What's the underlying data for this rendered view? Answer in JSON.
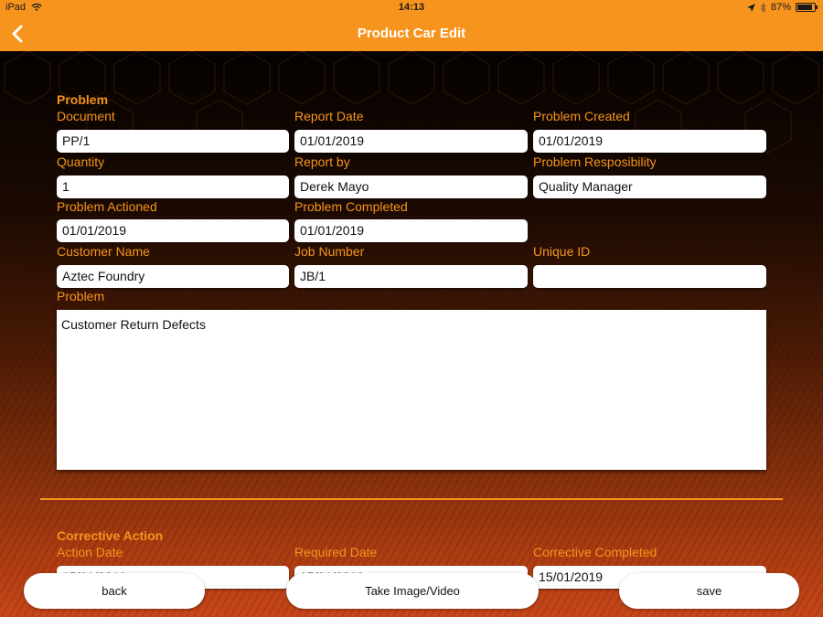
{
  "status_bar": {
    "device": "iPad",
    "time": "14:13",
    "battery": "87%",
    "battery_level": 0.87
  },
  "nav": {
    "title": "Product Car Edit",
    "back_icon": "chevron-left-icon"
  },
  "problem_section": {
    "title": "Problem",
    "fields": {
      "document": {
        "label": "Document",
        "value": "PP/1"
      },
      "report_date": {
        "label": "Report Date",
        "value": "01/01/2019"
      },
      "problem_created": {
        "label": "Problem Created",
        "value": "01/01/2019"
      },
      "quantity": {
        "label": "Quantity",
        "value": "1"
      },
      "report_by": {
        "label": "Report by",
        "value": "Derek Mayo"
      },
      "problem_responsibility": {
        "label": "Problem Resposibility",
        "value": "Quality Manager"
      },
      "problem_actioned": {
        "label": "Problem Actioned",
        "value": "01/01/2019"
      },
      "problem_completed": {
        "label": "Problem Completed",
        "value": "01/01/2019"
      },
      "customer_name": {
        "label": "Customer Name",
        "value": "Aztec Foundry"
      },
      "job_number": {
        "label": "Job Number",
        "value": "JB/1"
      },
      "unique_id": {
        "label": "Unique ID",
        "value": ""
      },
      "problem": {
        "label": "Problem",
        "value": "Customer Return Defects"
      }
    }
  },
  "corrective_section": {
    "title": "Corrective Action",
    "fields": {
      "action_date": {
        "label": "Action Date",
        "value": "15/01/2019"
      },
      "required_date": {
        "label": "Required Date",
        "value": "15/01/2019"
      },
      "corrective_completed": {
        "label": "Corrective Completed",
        "value": "15/01/2019"
      }
    }
  },
  "buttons": {
    "back": "back",
    "take_image": "Take Image/Video",
    "save": "save"
  },
  "colors": {
    "accent": "#f7941d",
    "field_bg": "#ffffff"
  }
}
